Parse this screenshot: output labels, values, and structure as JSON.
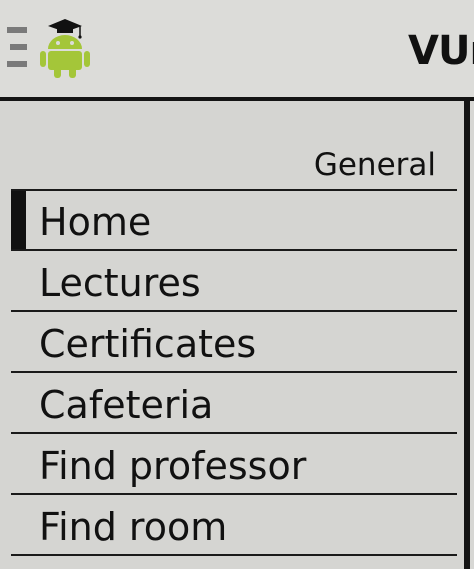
{
  "action_bar": {
    "title": "VUn",
    "drawer_icon": "drawer-menu-icon",
    "app_icon": "android-graduation-cap-icon"
  },
  "drawer": {
    "section_header": "General",
    "items": [
      {
        "label": "Home",
        "active": true
      },
      {
        "label": "Lectures",
        "active": false
      },
      {
        "label": "Certificates",
        "active": false
      },
      {
        "label": "Cafeteria",
        "active": false
      },
      {
        "label": "Find professor",
        "active": false
      },
      {
        "label": "Find room",
        "active": false
      }
    ]
  },
  "colors": {
    "android_green": "#a4c639",
    "background": "#d7d7d4",
    "divider": "#141414"
  }
}
